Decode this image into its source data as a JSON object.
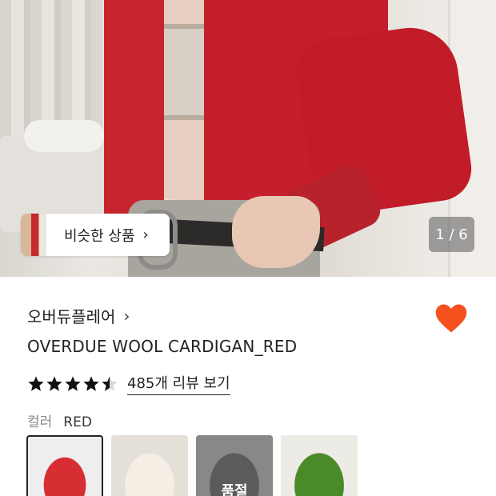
{
  "gallery": {
    "similar_button_label": "비슷한 상품",
    "counter": "1 / 6"
  },
  "product": {
    "brand": "오버듀플레어",
    "title": "OVERDUE WOOL CARDIGAN_RED",
    "rating": 4.5,
    "review_link": "485개 리뷰 보기",
    "wishlisted": true,
    "heart_color": "#f4511e"
  },
  "color_option": {
    "label": "컬러",
    "selected_value": "RED",
    "swatches": [
      {
        "name": "red",
        "sold_out_label": ""
      },
      {
        "name": "cream",
        "sold_out_label": ""
      },
      {
        "name": "grey",
        "sold_out_label": "품절"
      },
      {
        "name": "green",
        "sold_out_label": ""
      }
    ]
  },
  "icons": {
    "chevron": "chevron-right-icon",
    "heart": "heart-icon",
    "star": "star-icon"
  }
}
